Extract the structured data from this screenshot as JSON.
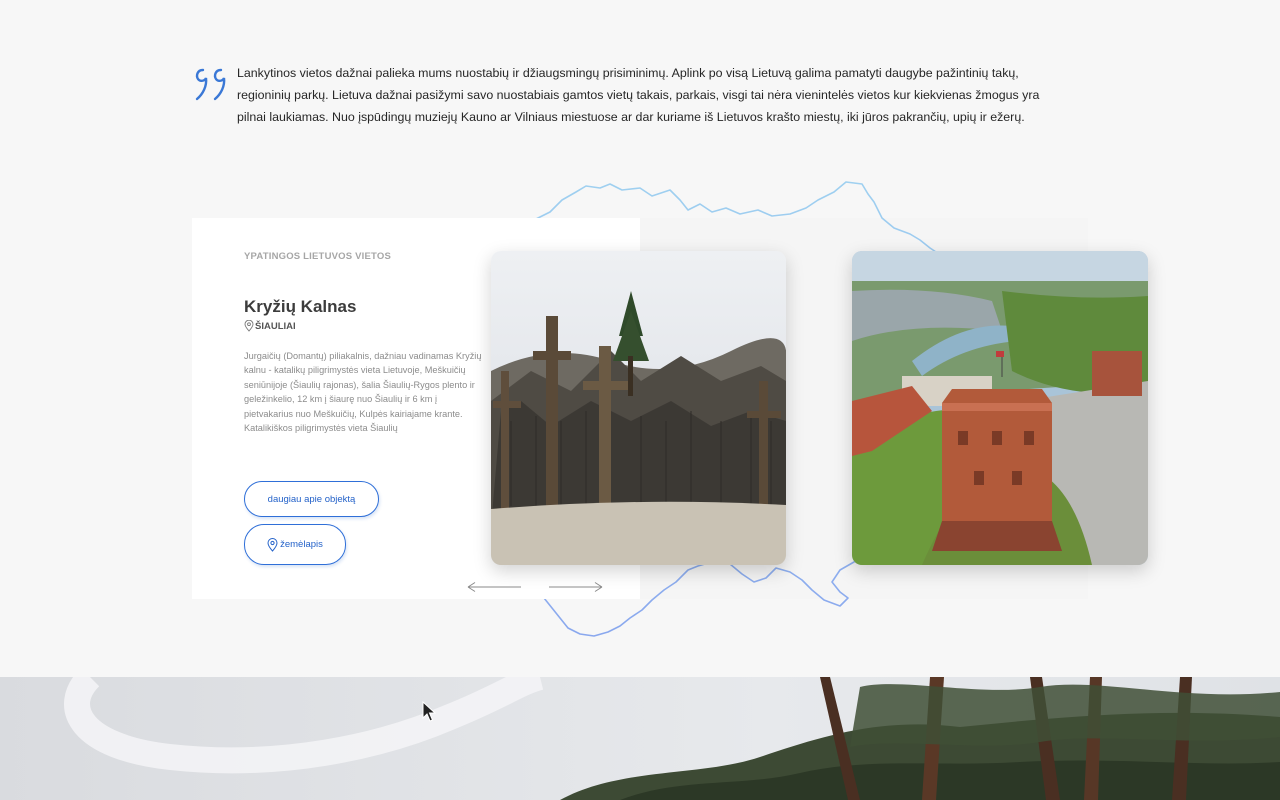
{
  "intro": {
    "quote_text": "Lankytinos vietos dažnai palieka mums nuostabių ir džiaugsmingų prisiminimų. Aplink po visą Lietuvą galima pamatyti daugybe pažintinių takų, regioninių parkų. Lietuva dažnai pasižymi savo nuostabiais gamtos vietų takais, parkais, visgi tai nėra vienintelės vietos kur kiekvienas žmogus yra pilnai laukiamas. Nuo įspūdingų muziejų Kauno ar Vilniaus miestuose ar dar kuriame iš Lietuvos krašto miestų, iki jūros pakrančių, upių ir ežerų."
  },
  "featured": {
    "eyebrow": "YPATINGOS LIETUVOS VIETOS",
    "title": "Kryžių Kalnas",
    "location": "ŠIAULIAI",
    "description": "Jurgaičių (Domantų) piliakalnis, dažniau vadinamas Kryžių kalnu - katalikų piligrimystės vieta Lietuvoje, Meškuičių seniūnijoje (Šiaulių rajonas), šalia Šiaulių-Rygos plento ir geležinkelio, 12 km į šiaurę nuo Šiaulių ir 6 km į pietvakarius nuo Meškuičių, Kulpės kairiajame krante. Katalikiškos piligrimystės vieta Šiaulių",
    "more_button": "daugiau apie objektą",
    "map_button": "žemėlapis"
  },
  "slides": [
    {
      "subject": "Hill of Crosses photo"
    },
    {
      "subject": "Gediminas castle tower photo"
    }
  ],
  "icons": {
    "quote": "quote-icon",
    "location": "map-pin-icon",
    "prev": "arrow-left-icon",
    "next": "arrow-right-icon"
  },
  "colors": {
    "accent": "#2462c9",
    "map_outline": "#8cc0ea",
    "background": "#f7f7f7"
  }
}
